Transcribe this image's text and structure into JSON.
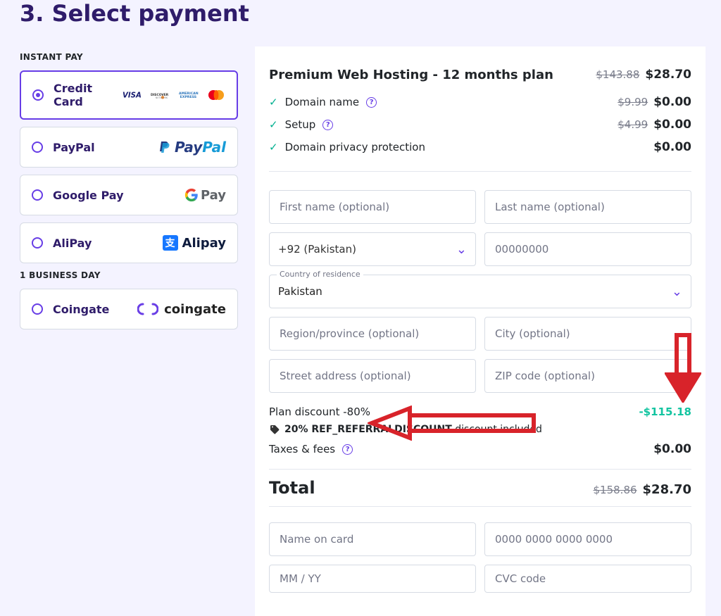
{
  "heading": "3. Select payment",
  "sidebar": {
    "instant_label": "INSTANT PAY",
    "delayed_label": "1 BUSINESS DAY",
    "options": {
      "credit": "Credit Card",
      "paypal": "PayPal",
      "gpay": "Google Pay",
      "alipay": "AliPay",
      "coingate": "Coingate"
    },
    "logos": {
      "paypal_a": "Pay",
      "paypal_b": "Pal",
      "gpay_pay": "Pay",
      "alipay": "Alipay",
      "coingate": "coingate"
    }
  },
  "summary": {
    "plan_title": "Premium Web Hosting - 12 months plan",
    "plan_old": "$143.88",
    "plan_price": "$28.70",
    "items": [
      {
        "label": "Domain name",
        "old": "$9.99",
        "price": "$0.00",
        "q": true
      },
      {
        "label": "Setup",
        "old": "$4.99",
        "price": "$0.00",
        "q": true
      },
      {
        "label": "Domain privacy protection",
        "old": "",
        "price": "$0.00",
        "q": false
      }
    ]
  },
  "form": {
    "first_name_ph": "First name (optional)",
    "last_name_ph": "Last name (optional)",
    "dial_value": "+92 (Pakistan)",
    "phone_ph": "00000000",
    "country_label": "Country of residence",
    "country_value": "Pakistan",
    "region_ph": "Region/province (optional)",
    "city_ph": "City (optional)",
    "street_ph": "Street address (optional)",
    "zip_ph": "ZIP code (optional)"
  },
  "discount": {
    "label": "Plan discount -80%",
    "amount": "-$115.18",
    "coupon_pct": "20% ",
    "coupon_code": "REF_REFERRALDISCOUNT",
    "coupon_tail": " discount included",
    "tax_label": "Taxes & fees",
    "tax_amount": "$0.00"
  },
  "total": {
    "label": "Total",
    "old": "$158.86",
    "price": "$28.70"
  },
  "card": {
    "name_ph": "Name on card",
    "num_ph": "0000 0000 0000 0000",
    "exp_ph": "MM / YY",
    "cvc_ph": "CVC code"
  }
}
